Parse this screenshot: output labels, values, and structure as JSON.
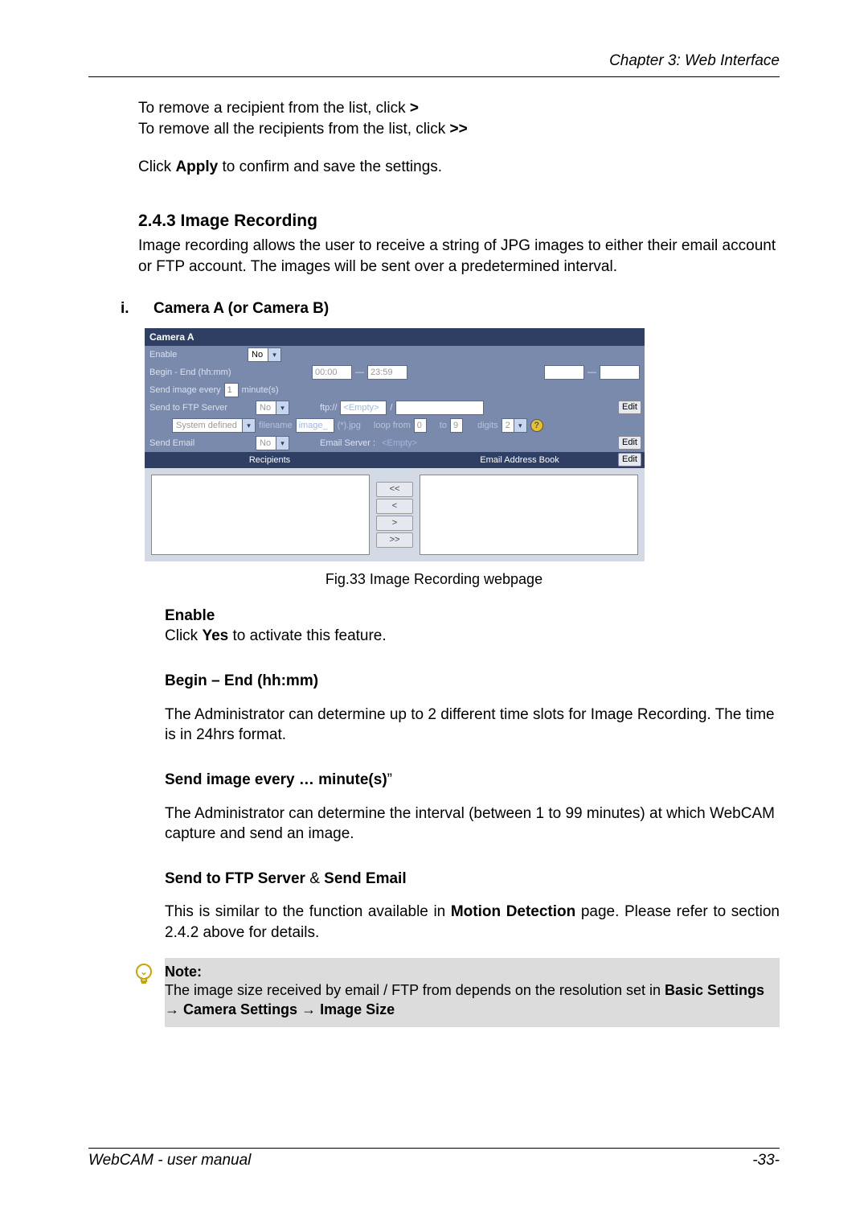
{
  "header": {
    "chapter": "Chapter 3: Web Interface"
  },
  "intro": {
    "line1_a": "To remove a recipient from the list, click ",
    "line1_b": ">",
    "line2_a": "To remove all the recipients from the list, click ",
    "line2_b": ">>",
    "line3_a": "Click ",
    "line3_b": "Apply",
    "line3_c": " to confirm and save the settings."
  },
  "section": {
    "number_title": "2.4.3 Image Recording",
    "body": "Image recording allows the user to receive a string of JPG images to either their email account or FTP account.    The images will be sent over a predetermined interval."
  },
  "sub_i": {
    "label": "i.",
    "title": "Camera A (or Camera B)"
  },
  "shot": {
    "title": "Camera A",
    "enable": {
      "label": "Enable",
      "value": "No"
    },
    "begin_end": {
      "label": "Begin - End (hh:mm)",
      "v1": "00:00",
      "dash": "—",
      "v2": "23:59",
      "dash2": "—"
    },
    "interval": {
      "label_a": "Send image every",
      "val": "1",
      "label_b": "minute(s)"
    },
    "ftp": {
      "label": "Send to FTP Server",
      "sel": "No",
      "prefix": "ftp://",
      "host": "<Empty>",
      "slash": "/",
      "edit": "Edit"
    },
    "filename": {
      "sys": "System defined",
      "fn_label": "filename",
      "fn_val": "image_",
      "ext": "(*).jpg",
      "loop_a": "loop from",
      "loop_from": "0",
      "loop_to_label": "to",
      "loop_to": "9",
      "digits_label": "digits",
      "digits": "2",
      "help": "?"
    },
    "email": {
      "label": "Send Email",
      "sel": "No",
      "server_label": "Email Server :",
      "server_val": "<Empty>",
      "edit": "Edit"
    },
    "lists": {
      "recipients": "Recipients",
      "book": "Email Address Book",
      "edit": "Edit",
      "bll": "<<",
      "bl": "<",
      "br": ">",
      "brr": ">>"
    }
  },
  "figcap": "Fig.33  Image Recording webpage",
  "enable_sec": {
    "h": "Enable",
    "body_a": "Click ",
    "body_b": "Yes",
    "body_c": " to activate this feature."
  },
  "begin_sec": {
    "h": "Begin – End (hh:mm)",
    "body": "The Administrator can determine up to 2 different time slots for Image Recording.  The time is in 24hrs format."
  },
  "interval_sec": {
    "h": "Send image every … minute(s)",
    "q": "”",
    "body": "The Administrator can determine the interval (between 1 to 99 minutes) at which WebCAM capture and send an image."
  },
  "ftp_sec": {
    "h_a": "Send to FTP Server",
    "amp": " & ",
    "h_b": "Send Email",
    "body_a": "This is similar to the function available in ",
    "body_b": "Motion Detection",
    "body_c": " page. Please refer to section 2.4.2 above for details."
  },
  "note": {
    "h": "Note:",
    "body_a": "The image size received by email / FTP from depends on the resolution set in ",
    "body_b": "Basic Settings",
    "arrow": " → ",
    "body_c": "Camera Settings",
    "body_d": "Image Size"
  },
  "footer": {
    "left": "WebCAM - user manual",
    "right": "-33-"
  }
}
